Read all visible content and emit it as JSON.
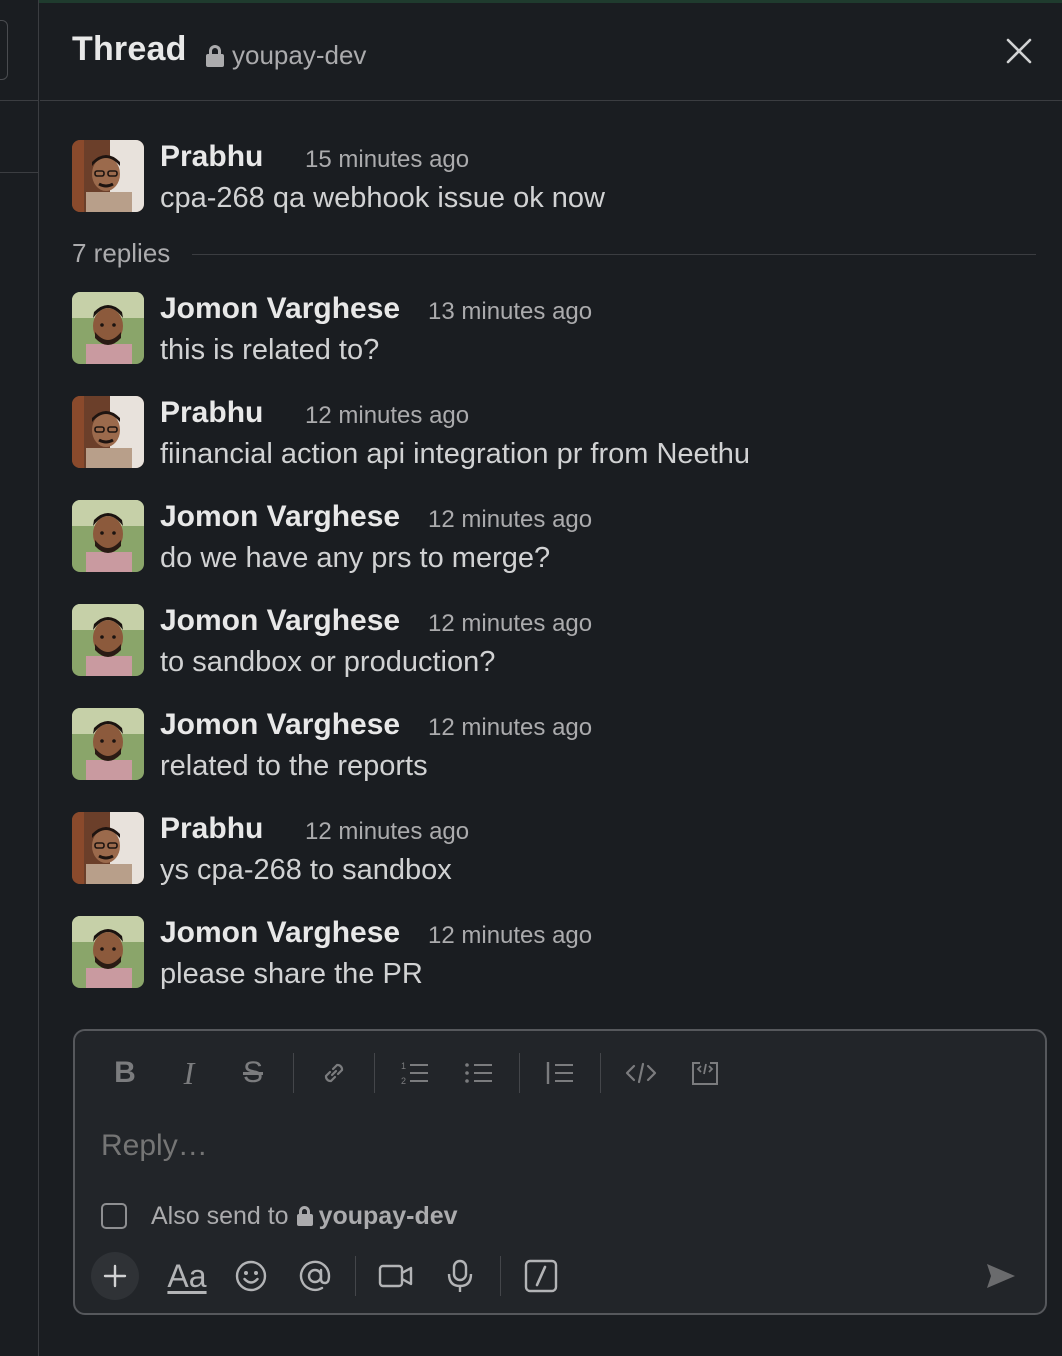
{
  "header": {
    "title": "Thread",
    "channel": "youpay-dev"
  },
  "parent": {
    "author": "Prabhu",
    "time": "15 minutes ago",
    "text": "cpa-268 qa webhook issue ok now"
  },
  "replies_label": "7 replies",
  "replies": [
    {
      "author": "Jomon Varghese",
      "time": "13 minutes ago",
      "text": "this is related to?"
    },
    {
      "author": "Prabhu",
      "time": "12 minutes ago",
      "text": "fiinancial action api integration pr from Neethu"
    },
    {
      "author": "Jomon Varghese",
      "time": "12 minutes ago",
      "text": "do we have any prs to merge?"
    },
    {
      "author": "Jomon Varghese",
      "time": "12 minutes ago",
      "text": "to sandbox or production?"
    },
    {
      "author": "Jomon Varghese",
      "time": "12 minutes ago",
      "text": "related to the reports"
    },
    {
      "author": "Prabhu",
      "time": "12 minutes ago",
      "text": "ys cpa-268 to sandbox"
    },
    {
      "author": "Jomon Varghese",
      "time": "12 minutes ago",
      "text": "please share the PR"
    }
  ],
  "composer": {
    "placeholder": "Reply…",
    "also_send_label": "Also send to",
    "also_send_channel": "youpay-dev",
    "aa_label": "Aa"
  }
}
